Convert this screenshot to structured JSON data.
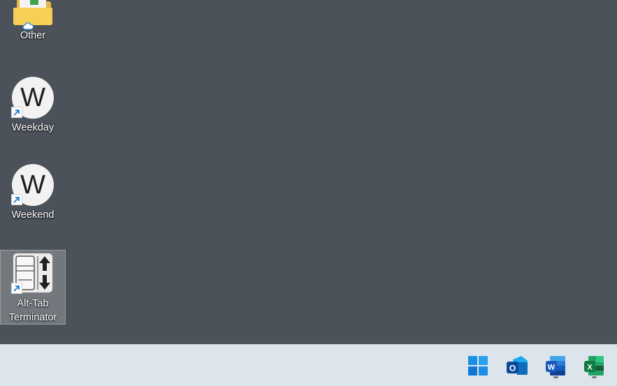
{
  "desktop": {
    "icons": [
      {
        "label": "Other",
        "icon": "folder-icon",
        "badge": "cloud-sync-icon"
      },
      {
        "label": "Weekday",
        "icon": "w-app-icon",
        "glyph": "W",
        "badge": "shortcut-arrow-icon"
      },
      {
        "label": "Weekend",
        "icon": "w-app-icon",
        "glyph": "W",
        "badge": "shortcut-arrow-icon"
      },
      {
        "label_line1": "Alt-Tab",
        "label_line2": "Terminator",
        "icon": "alt-tab-terminator-icon",
        "badge": "shortcut-arrow-icon",
        "selected": true
      }
    ]
  },
  "taskbar": {
    "buttons": [
      {
        "name": "start",
        "icon": "windows-start-icon",
        "running": false
      },
      {
        "name": "outlook",
        "icon": "outlook-icon",
        "glyph": "O",
        "running": false
      },
      {
        "name": "word",
        "icon": "word-icon",
        "glyph": "W",
        "running": true
      },
      {
        "name": "excel",
        "icon": "excel-icon",
        "glyph": "X",
        "running": true
      }
    ]
  },
  "colors": {
    "desktop_bg": "#4b525a",
    "taskbar_bg": "#dde5ec",
    "accent_blue": "#0f6cbd",
    "word_blue": "#185abd",
    "excel_green": "#107c41"
  }
}
